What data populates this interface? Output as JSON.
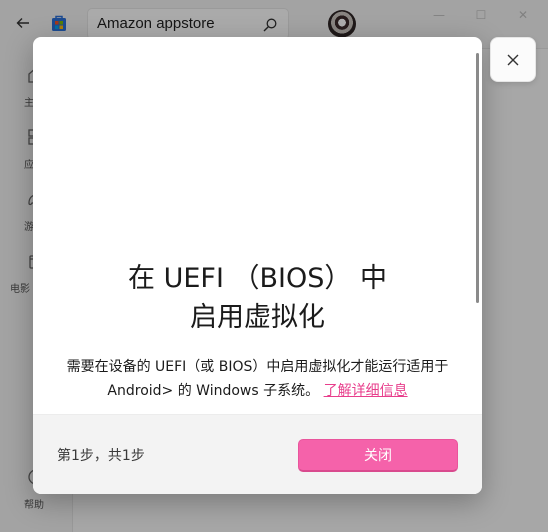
{
  "search": {
    "value": "Amazon appstore"
  },
  "sidebar": {
    "items": [
      {
        "label": "主",
        "icon": "home-icon"
      },
      {
        "label": "应",
        "icon": "apps-icon"
      },
      {
        "label": "游",
        "icon": "gaming-icon"
      },
      {
        "label": "电影",
        "icon": "movies-icon"
      },
      {
        "label": "帮助",
        "icon": "help-icon"
      }
    ]
  },
  "dialog": {
    "title_line1": "在 UEFI （BIOS） 中",
    "title_line2": "启用虚拟化",
    "body_text": "需要在设备的 UEFI（或 BIOS）中启用虚拟化才能运行适用于 Android> 的 Windows 子系统。",
    "learn_more": "了解详细信息",
    "step_text": "第1步，共1步",
    "close_label": "关闭"
  },
  "colors": {
    "accent": "#f562aa",
    "link": "#e83e8c"
  }
}
